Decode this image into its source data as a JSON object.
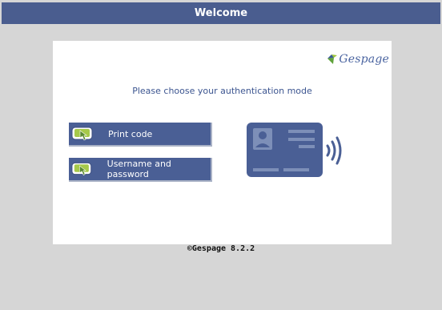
{
  "window": {
    "title": "Welcome"
  },
  "logo": {
    "text": "Gespage"
  },
  "auth": {
    "prompt": "Please choose your authentication mode",
    "options": [
      {
        "label": "Print code",
        "icon": "hand-touch-icon"
      },
      {
        "label": "Username and password",
        "icon": "hand-touch-icon"
      }
    ]
  },
  "footer": {
    "text": "©Gespage 8.2.2"
  },
  "colors": {
    "titlebar": "#4a5d8f",
    "button": "#4a5f95",
    "card": "#4a5f95",
    "background": "#d6d6d6",
    "accent_green": "#9ec43a"
  }
}
